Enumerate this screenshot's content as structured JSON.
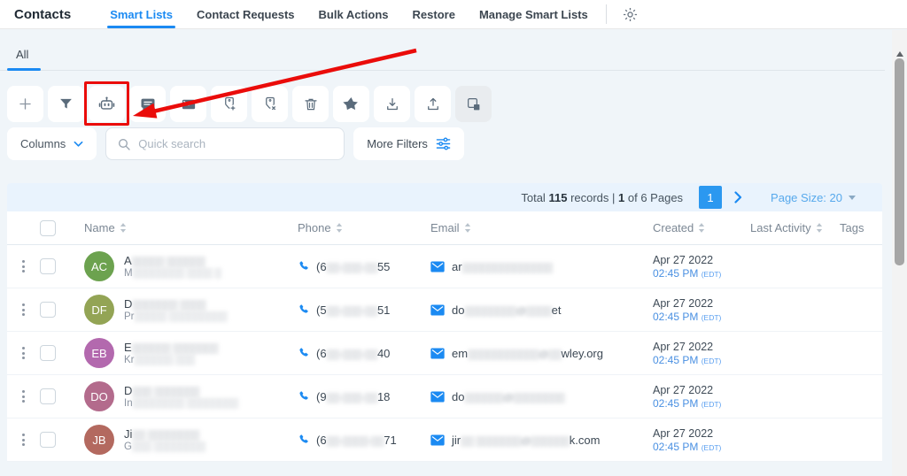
{
  "topbar": {
    "title": "Contacts",
    "tabs": [
      {
        "label": "Smart Lists",
        "active": true
      },
      {
        "label": "Contact Requests",
        "active": false
      },
      {
        "label": "Bulk Actions",
        "active": false
      },
      {
        "label": "Restore",
        "active": false
      },
      {
        "label": "Manage Smart Lists",
        "active": false
      }
    ],
    "gear_icon": "settings-gear"
  },
  "list_tabs": {
    "active_label": "All"
  },
  "toolbar": {
    "icons": [
      "add-contact",
      "filter-funnel",
      "automation-robot",
      "send-sms",
      "send-email",
      "add-tag",
      "remove-tag",
      "delete-trash",
      "favorite-star",
      "import-download",
      "export-upload",
      "merge-contacts"
    ],
    "highlighted_icon": "automation-robot",
    "annotation_color": "#ea0c0a"
  },
  "filter_bar": {
    "columns_label": "Columns",
    "search_placeholder": "Quick search",
    "more_filters_label": "More Filters"
  },
  "pagination": {
    "total_prefix": "Total",
    "total": "115",
    "records_mid": "records |",
    "current": "1",
    "pages_suffix": "of 6 Pages",
    "page_box": "1",
    "page_size_label": "Page Size: 20"
  },
  "table": {
    "headers": {
      "name": "Name",
      "phone": "Phone",
      "email": "Email",
      "created": "Created",
      "last_activity": "Last Activity",
      "tags": "Tags"
    },
    "rows": [
      {
        "initials": "AC",
        "avatar_color": "#6ca24f",
        "name_pre": "A",
        "name_red": "▒▒▒▒▒ ▒▒▒▒▒▒",
        "sub_pre": "M",
        "sub_red": "▒▒▒▒▒▒▒▒ ▒▒▒▒ ▒",
        "phone_pre": "(6",
        "phone_red": "▒▒-▒▒▒-▒▒",
        "phone_suf": "55",
        "email_pre": "ar",
        "email_red": "▒▒▒▒▒▒▒▒▒▒▒▒▒▒",
        "email_suf": "",
        "date": "Apr 27 2022",
        "time": "02:45 PM",
        "tz": "(EDT)"
      },
      {
        "initials": "DF",
        "avatar_color": "#93a455",
        "name_pre": "D",
        "name_red": "▒▒▒▒▒▒▒ ▒▒▒▒",
        "sub_pre": "Pr",
        "sub_red": "▒▒▒▒▒ ▒▒▒▒▒▒▒▒▒",
        "phone_pre": "(5",
        "phone_red": "▒▒-▒▒▒-▒▒",
        "phone_suf": "51",
        "email_pre": "do",
        "email_red": "▒▒▒▒▒▒▒▒@▒▒▒▒",
        "email_suf": "et",
        "date": "Apr 27 2022",
        "time": "02:45 PM",
        "tz": "(EDT)"
      },
      {
        "initials": "EB",
        "avatar_color": "#b369ae",
        "name_pre": "E",
        "name_red": "▒▒▒▒▒▒ ▒▒▒▒▒▒▒",
        "sub_pre": "Kr",
        "sub_red": "▒▒▒▒▒▒ ▒▒▒",
        "phone_pre": "(6",
        "phone_red": "▒▒-▒▒▒-▒▒",
        "phone_suf": "40",
        "email_pre": "em",
        "email_red": "▒▒▒▒▒▒▒▒▒▒▒@▒▒",
        "email_suf": "wley.org",
        "date": "Apr 27 2022",
        "time": "02:45 PM",
        "tz": "(EDT)"
      },
      {
        "initials": "DO",
        "avatar_color": "#b36b8c",
        "name_pre": "D",
        "name_red": "▒▒▒ ▒▒▒▒▒▒▒",
        "sub_pre": "In",
        "sub_red": "▒▒▒▒▒▒▒▒ ▒▒▒▒▒▒▒▒",
        "phone_pre": "(9",
        "phone_red": "▒▒-▒▒▒-▒▒",
        "phone_suf": "18",
        "email_pre": "do",
        "email_red": "▒▒▒▒▒▒@▒▒▒▒▒▒▒▒",
        "email_suf": "",
        "date": "Apr 27 2022",
        "time": "02:45 PM",
        "tz": "(EDT)"
      },
      {
        "initials": "JB",
        "avatar_color": "#b3695f",
        "name_pre": "Ji",
        "name_red": "▒▒ ▒▒▒▒▒▒▒▒",
        "sub_pre": "G",
        "sub_red": "▒▒▒ ▒▒▒▒▒▒▒▒",
        "phone_pre": "(6",
        "phone_red": "▒▒-▒▒▒▒-▒▒",
        "phone_suf": "71",
        "email_pre": "jir",
        "email_red": "▒▒ ▒▒▒▒▒▒▒@▒▒▒▒▒▒",
        "email_suf": "k.com",
        "date": "Apr 27 2022",
        "time": "02:45 PM",
        "tz": "(EDT)"
      }
    ]
  },
  "colors": {
    "accent_blue": "#1b8af2",
    "page_box_blue": "#2b98f0",
    "annotation_red": "#ea0c0a",
    "pagination_bg": "#e9f3fd",
    "time_blue": "#4a90e2"
  }
}
